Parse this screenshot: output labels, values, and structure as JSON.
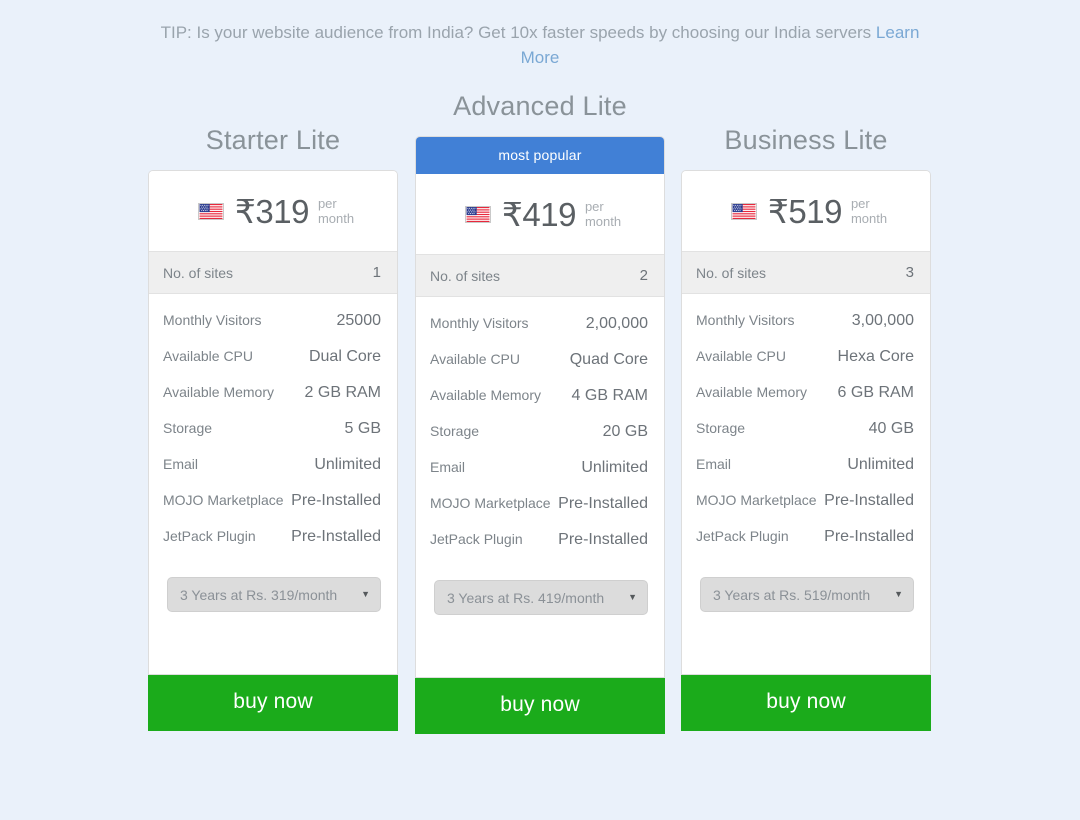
{
  "tip": {
    "text": "TIP: Is your website audience from India? Get 10x faster speeds by choosing our India servers",
    "link_label": "Learn More",
    "link_color": "#7aa8d4"
  },
  "colors": {
    "page_background": "#eaf1fa",
    "ribbon_blue": "#4180d6",
    "buy_green": "#1bab1b",
    "highlight_row": "#efefef"
  },
  "feature_labels": {
    "sites": "No. of sites",
    "visitors": "Monthly Visitors",
    "cpu": "Available CPU",
    "memory": "Available Memory",
    "storage": "Storage",
    "email": "Email",
    "marketplace": "MOJO Marketplace",
    "jetpack": "JetPack Plugin"
  },
  "common": {
    "price_period": "per\nmonth",
    "price_period_line1": "per",
    "price_period_line2": "month",
    "buy_label": "buy now",
    "currency_symbol": "₹",
    "flag_icon": "us-flag-icon",
    "caret_icon": "chevron-down-icon"
  },
  "plans": [
    {
      "id": "starter-lite",
      "title": "Starter Lite",
      "ribbon": null,
      "price": "₹319",
      "price_period_line1": "per",
      "price_period_line2": "month",
      "sites": "1",
      "visitors": "25000",
      "cpu": "Dual Core",
      "memory": "2 GB RAM",
      "storage": "5 GB",
      "email": "Unlimited",
      "marketplace": "Pre-Installed",
      "jetpack": "Pre-Installed",
      "term": "3 Years at Rs. 319/month",
      "buy_label": "buy now"
    },
    {
      "id": "advanced-lite",
      "title": "Advanced Lite",
      "ribbon": "most popular",
      "price": "₹419",
      "price_period_line1": "per",
      "price_period_line2": "month",
      "sites": "2",
      "visitors": "2,00,000",
      "cpu": "Quad Core",
      "memory": "4 GB RAM",
      "storage": "20 GB",
      "email": "Unlimited",
      "marketplace": "Pre-Installed",
      "jetpack": "Pre-Installed",
      "term": "3 Years at Rs. 419/month",
      "buy_label": "buy now"
    },
    {
      "id": "business-lite",
      "title": "Business Lite",
      "ribbon": null,
      "price": "₹519",
      "price_period_line1": "per",
      "price_period_line2": "month",
      "sites": "3",
      "visitors": "3,00,000",
      "cpu": "Hexa Core",
      "memory": "6 GB RAM",
      "storage": "40 GB",
      "email": "Unlimited",
      "marketplace": "Pre-Installed",
      "jetpack": "Pre-Installed",
      "term": "3 Years at Rs. 519/month",
      "buy_label": "buy now"
    }
  ]
}
